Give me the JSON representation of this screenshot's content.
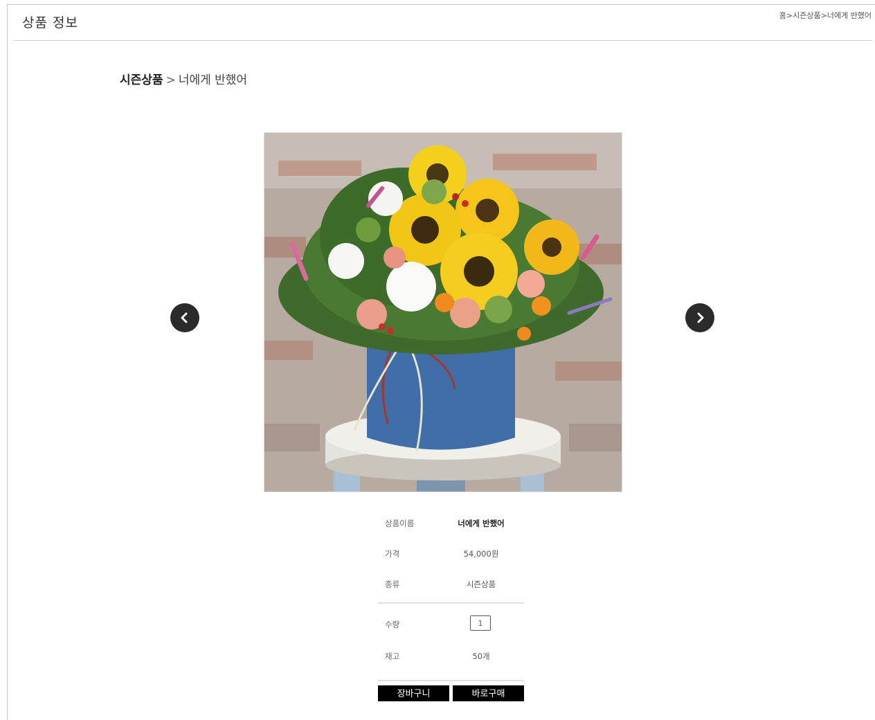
{
  "page": {
    "title": "상품 정보",
    "top_breadcrumb": "홈>시즌상품>너에게 반했어"
  },
  "breadcrumb": {
    "category": "시즌상품",
    "separator": ">",
    "item": "너에게 반했어"
  },
  "carousel": {
    "prev_icon": "chevron-left-icon",
    "next_icon": "chevron-right-icon"
  },
  "product": {
    "name_label": "상품이름",
    "name_value": "너에게 반했어",
    "price_label": "가격",
    "price_value": "54,000원",
    "type_label": "종류",
    "type_value": "시즌상품",
    "qty_label": "수량",
    "qty_value": "1",
    "stock_label": "재고",
    "stock_value": "50개"
  },
  "actions": {
    "cart_label": "장바구니",
    "buy_label": "바로구매"
  }
}
